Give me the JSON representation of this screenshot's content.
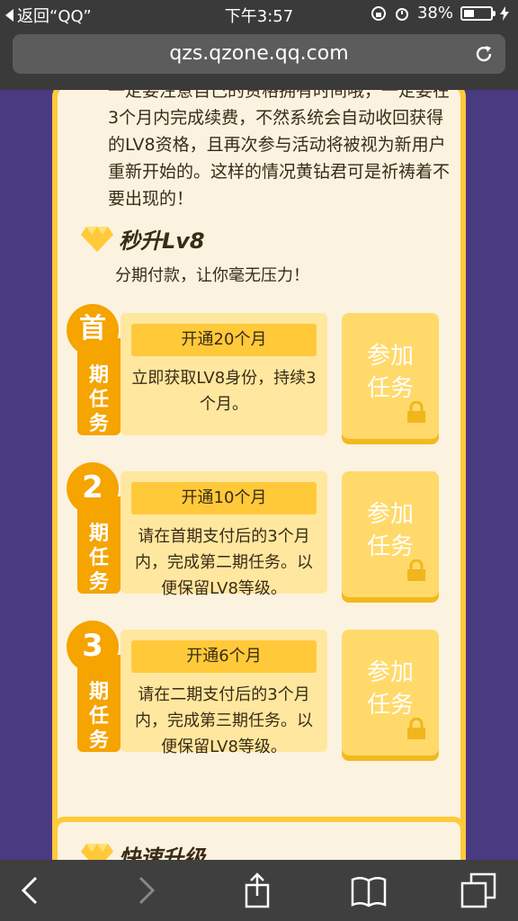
{
  "status": {
    "back_app": "返回“QQ”",
    "time": "下午3:57",
    "battery": "38%",
    "battery_level": 0.38
  },
  "browser": {
    "url": "qzs.qzone.qq.com"
  },
  "intro": {
    "text": "一定要注意自己的资格拥有时间哦，一定要在3个月内完成续费，不然系统会自动收回获得的LV8资格，且再次参与活动将被视为新用户重新开始的。这样的情况黄钻君可是祈祷着不要出现的！"
  },
  "section": {
    "title": "秒升Lv8",
    "subtitle": "分期付款，让你毫无压力！"
  },
  "tasks": [
    {
      "badge": "首",
      "side": "期任务",
      "tag": "开通20个月",
      "desc": "立即获取LV8身份，持续3个月。",
      "button": "参加任务"
    },
    {
      "badge": "2",
      "side": "期任务",
      "tag": "开通10个月",
      "desc": "请在首期支付后的3个月内，完成第二期任务。以便保留LV8等级。",
      "button": "参加任务"
    },
    {
      "badge": "3",
      "side": "期任务",
      "tag": "开通6个月",
      "desc": "请在二期支付后的3个月内，完成第三期任务。以便保留LV8等级。",
      "button": "参加任务"
    }
  ],
  "next_section": {
    "title": "快速升级"
  },
  "colors": {
    "accent": "#f5a400",
    "card_bg": "#fbf3e0",
    "page_bg": "#4a3a82",
    "button": "#ffd96a"
  },
  "icons": [
    "back-icon",
    "alarm-icon",
    "lock-rotation-icon",
    "battery-icon",
    "reload-icon",
    "diamond-icon",
    "lock-icon",
    "share-icon",
    "bookmarks-icon",
    "tabs-icon",
    "forward-icon"
  ]
}
